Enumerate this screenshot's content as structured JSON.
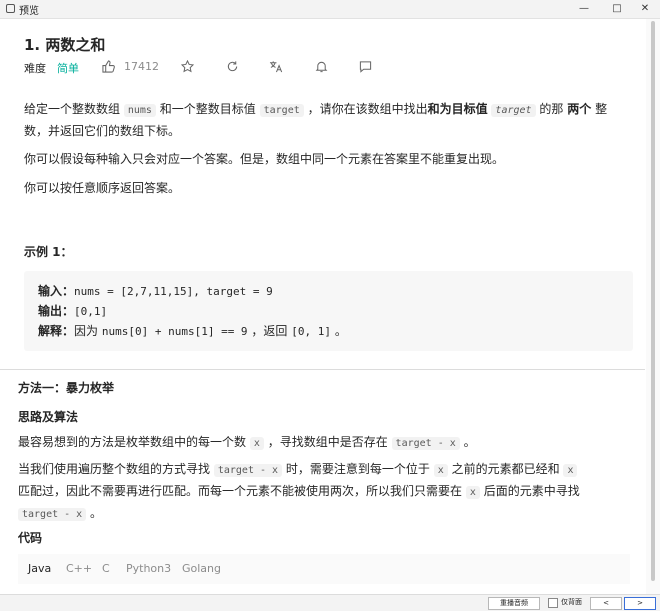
{
  "window": {
    "title": "预览",
    "minimize": "—",
    "maximize": "□",
    "close": "✕"
  },
  "problem": {
    "title": "1. 两数之和",
    "difficulty_label": "难度",
    "difficulty": "简单",
    "likes": "17412",
    "icons": [
      "thumbs-up-icon",
      "star-icon",
      "share-icon",
      "translate-icon",
      "bell-icon",
      "comment-icon"
    ]
  },
  "description": {
    "p1_a": "给定一个整数数组",
    "p1_code1": "nums",
    "p1_b": "和一个整数目标值",
    "p1_code2": "target",
    "p1_c": "，请你在该数组中找出",
    "p1_bold1": "和为目标值",
    "p1_code3": "target",
    "p1_d": "的那",
    "p1_bold2": "两个",
    "p1_e": "整",
    "p1_line2": "数，并返回它们的数组下标。",
    "p2": "你可以假设每种输入只会对应一个答案。但是，数组中同一个元素在答案里不能重复出现。",
    "p3": "你可以按任意顺序返回答案。"
  },
  "example": {
    "heading": "示例 1：",
    "input_label": "输入：",
    "input_value": "nums = [2,7,11,15], target = 9",
    "output_label": "输出：",
    "output_value": "[0,1]",
    "explain_label": "解释：",
    "explain_a": "因为",
    "explain_code": "nums[0] + nums[1] == 9",
    "explain_b": "，返回",
    "explain_code2": "[0, 1]",
    "explain_c": "。"
  },
  "solution": {
    "method_title": "方法一：暴力枚举",
    "idea_title": "思路及算法",
    "s1_a": "最容易想到的方法是枚举数组中的每一个数",
    "s1_code1": "x",
    "s1_b": "，寻找数组中是否存在",
    "s1_code2": "target - x",
    "s1_c": "。",
    "s2_a": "当我们使用遍历整个数组的方式寻找",
    "s2_code1": "target - x",
    "s2_b": "时，需要注意到每一个位于",
    "s2_code2": "x",
    "s2_c": "之前的元素都已经和",
    "s2_code3": "x",
    "s2_d": "匹配过，因此不需要再进行匹配。而每一个元素不能被使用两次，所以我们只需要在",
    "s2_code4": "x",
    "s2_e": "后面的元素中寻找",
    "s2_code5": "target - x",
    "s2_f": "。",
    "code_title": "代码"
  },
  "code_tabs": [
    "Java",
    "C++",
    "C",
    "Python3",
    "Golang"
  ],
  "bottom": {
    "replay": "重播音频",
    "checkbox_label": "仅背面",
    "prev": "<",
    "next": ">"
  }
}
